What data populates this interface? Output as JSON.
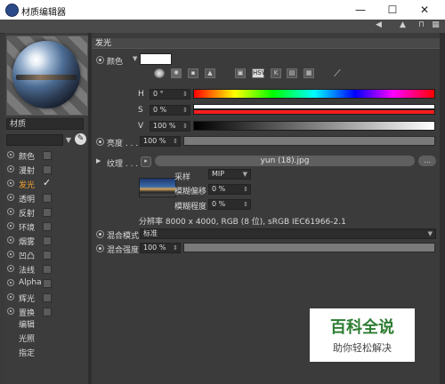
{
  "window": {
    "title": "材质编辑器",
    "minimize": "—",
    "maximize": "☐",
    "close": "✕"
  },
  "menustrip_icons": [
    "arrow-left-icon",
    "arrow-up-icon",
    "lock-icon",
    "grid-icon"
  ],
  "left": {
    "material_label": "材质",
    "search_value": "",
    "channels": [
      {
        "label": "颜色",
        "checked": false
      },
      {
        "label": "漫射",
        "checked": false
      },
      {
        "label": "发光",
        "checked": true,
        "active": true
      },
      {
        "label": "透明",
        "checked": false
      },
      {
        "label": "反射",
        "checked": false
      },
      {
        "label": "环境",
        "checked": false
      },
      {
        "label": "烟雾",
        "checked": false
      },
      {
        "label": "凹凸",
        "checked": false
      },
      {
        "label": "法线",
        "checked": false
      },
      {
        "label": "Alpha",
        "checked": false
      },
      {
        "label": "辉光",
        "checked": false
      },
      {
        "label": "置换",
        "checked": false
      }
    ],
    "extra": [
      "编辑",
      "光照",
      "指定"
    ]
  },
  "right": {
    "section_title": "发光",
    "color_label": "颜色",
    "color_swatch": "#ffffff",
    "picker_modes": [
      "wheel-icon",
      "spectrum-icon",
      "image-icon",
      "kelvin-icon",
      "rgb-icon",
      "HSV",
      "k-icon",
      "mix-icon",
      "palette-icon",
      "eyedropper-icon"
    ],
    "h_label": "H",
    "h_value": "0 °",
    "s_label": "S",
    "s_value": "0 %",
    "v_label": "V",
    "v_value": "100 %",
    "brightness_label": "亮度 . . .",
    "brightness_value": "100 %",
    "brightness_level": 1.0,
    "texture_label": "纹理 . . .",
    "texture_file": "yun (18).jpg",
    "sampling_label": "采样",
    "sampling_value": "MIP",
    "blur_offset_label": "模糊偏移",
    "blur_offset_value": "0 %",
    "blur_scale_label": "模糊程度",
    "blur_scale_value": "0 %",
    "resolution_info": "分辨率 8000 x 4000, RGB (8 位), sRGB IEC61966-2.1",
    "blend_mode_label": "混合模式",
    "blend_mode_value": "标准",
    "blend_strength_label": "混合强度",
    "blend_strength_value": "100 %",
    "blend_strength_level": 1.0
  },
  "watermark": {
    "line1": "百科全说",
    "line2": "助你轻松解决"
  }
}
